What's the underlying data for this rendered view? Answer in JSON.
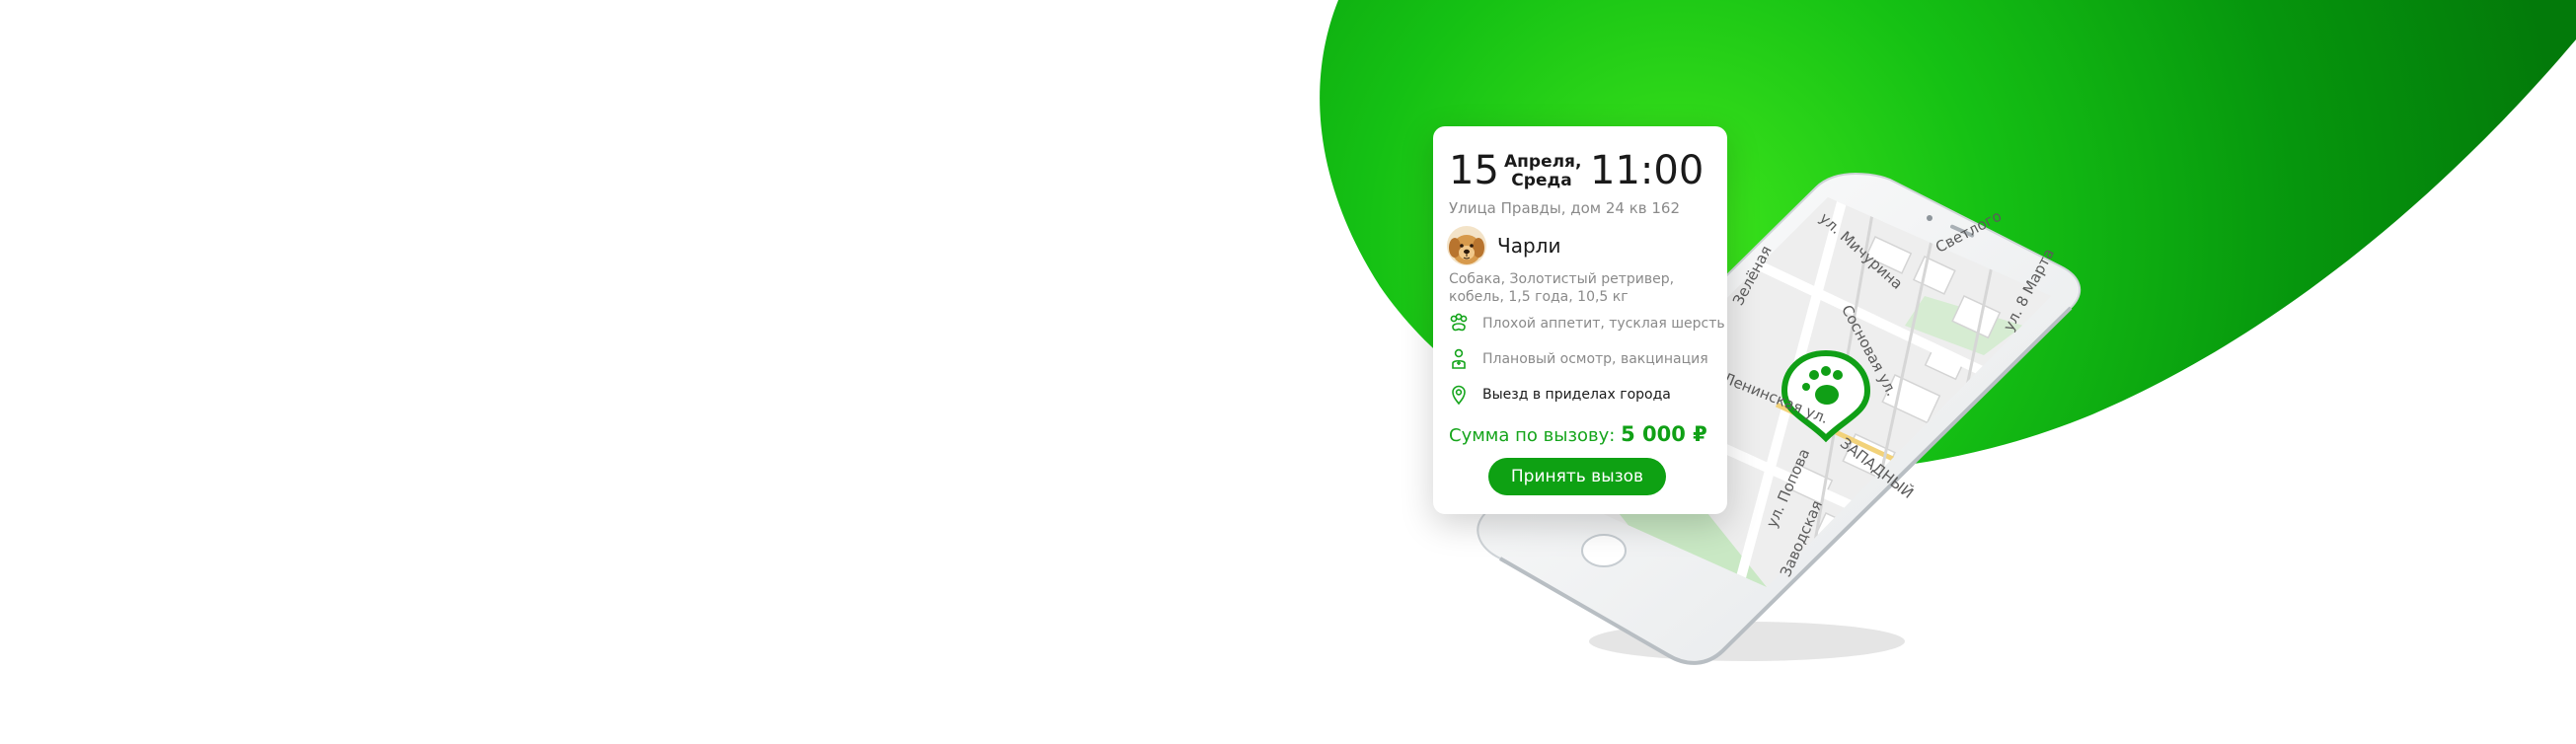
{
  "colors": {
    "brand_green": "#0ea113",
    "bright_green": "#2ddc1a",
    "muted_text": "#8a8a8a",
    "dark_text": "#1a1a1a"
  },
  "card": {
    "date_day": "15",
    "date_month": "Апреля,",
    "date_weekday": "Среда",
    "time": "11:00",
    "address": "Улица Правды, дом 24 кв 162",
    "pet": {
      "name": "Чарли",
      "avatar_icon": "golden-retriever-avatar",
      "description": "Собака, Золотистый ретривер, кобель, 1,5 года, 10,5 кг"
    },
    "details": [
      {
        "icon": "paw-icon",
        "text": "Плохой аппетит, тусклая шерсть"
      },
      {
        "icon": "vet-icon",
        "text": "Плановый осмотр, вакцинация"
      },
      {
        "icon": "location-pin-icon",
        "text": "Выезд в приделах города"
      }
    ],
    "sum_label": "Сумма по вызову:",
    "sum_value": "5 000 ₽",
    "accept_button": "Принять вызов"
  },
  "map": {
    "marker_icon": "paw-map-marker-icon",
    "streets": [
      "ул. Мичурина",
      "Светлого",
      "Сосновая ул.",
      "ул. 8 Марта",
      "Зелёная",
      "Ленинская ул.",
      "ЗАПАДНЫЙ",
      "ул. Попова",
      "Заводская"
    ]
  }
}
